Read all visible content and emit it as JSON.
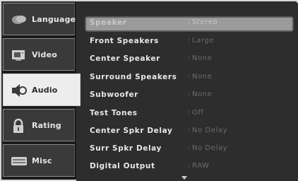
{
  "tabs": [
    {
      "label": "Language",
      "icon": "speech-bubble-icon",
      "active": false
    },
    {
      "label": "Video",
      "icon": "monitor-icon",
      "active": false
    },
    {
      "label": "Audio",
      "icon": "speaker-icon",
      "active": true
    },
    {
      "label": "Rating",
      "icon": "padlock-icon",
      "active": false
    },
    {
      "label": "Misc",
      "icon": "keyboard-icon",
      "active": false
    }
  ],
  "settings": [
    {
      "name": "Speaker",
      "value": "Stereo",
      "selected": true
    },
    {
      "name": "Front Speakers",
      "value": "Large"
    },
    {
      "name": "Center Speaker",
      "value": "None"
    },
    {
      "name": "Surround Speakers",
      "value": "None"
    },
    {
      "name": "Subwoofer",
      "value": "None"
    },
    {
      "name": "Test Tones",
      "value": "Off"
    },
    {
      "name": "Center Spkr Delay",
      "value": "No Delay"
    },
    {
      "name": "Surr Spkr Delay",
      "value": "No Delay"
    },
    {
      "name": "Digital Output",
      "value": "RAW"
    }
  ],
  "scroll_indicator": "scroll-down-arrow-icon"
}
